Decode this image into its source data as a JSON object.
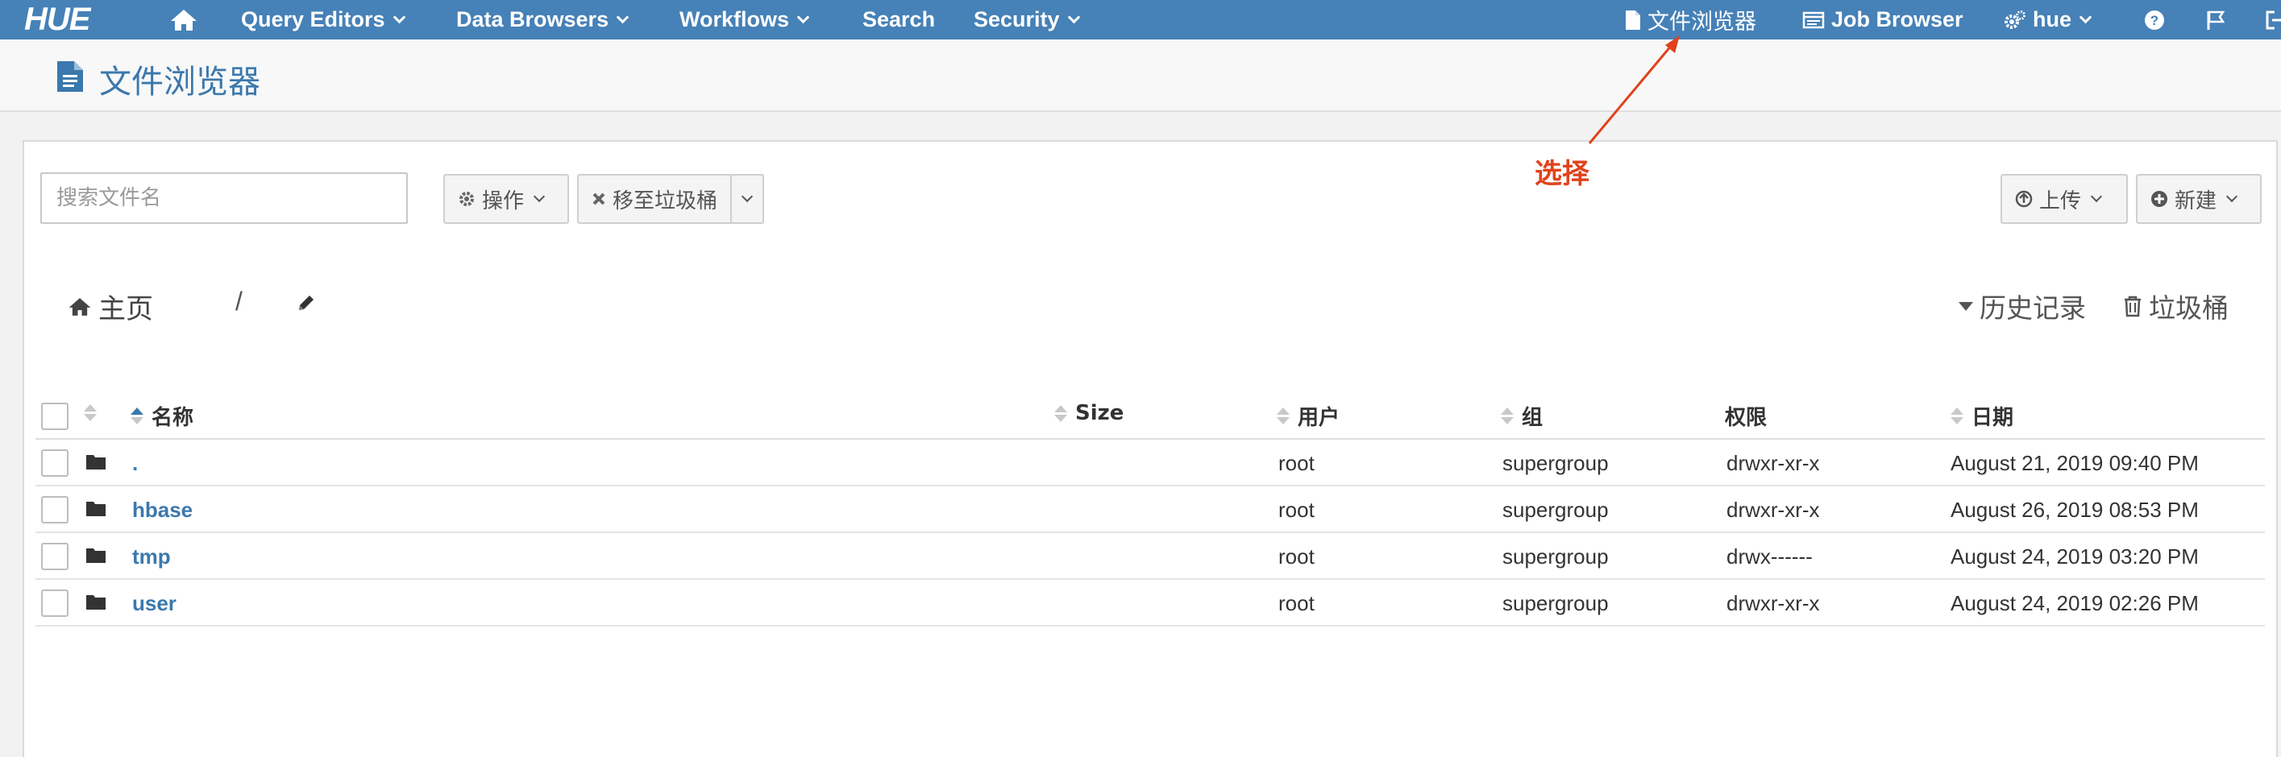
{
  "topnav": {
    "logo": "HUE",
    "menus": [
      {
        "label": "Query Editors"
      },
      {
        "label": "Data Browsers"
      },
      {
        "label": "Workflows"
      },
      {
        "label": "Search"
      },
      {
        "label": "Security"
      }
    ],
    "file_browser_label": "文件浏览器",
    "job_browser_label": "Job Browser",
    "user_label": "hue"
  },
  "header": {
    "title": "文件浏览器"
  },
  "toolbar": {
    "search_placeholder": "搜索文件名",
    "actions_label": "操作",
    "trash_move_label": "移至垃圾桶",
    "upload_label": "上传",
    "new_label": "新建"
  },
  "annotation": {
    "text": "选择",
    "color": "#e0421c"
  },
  "breadcrumb": {
    "home_label": "主页",
    "separator": "/"
  },
  "right_links": {
    "history_label": "历史记录",
    "trash_label": "垃圾桶"
  },
  "table": {
    "columns": {
      "name": "名称",
      "size": "Size",
      "user": "用户",
      "group": "组",
      "permissions": "权限",
      "date": "日期"
    },
    "rows": [
      {
        "name": ".",
        "size": "",
        "user": "root",
        "group": "supergroup",
        "permissions": "drwxr-xr-x",
        "date": "August 21, 2019 09:40 PM"
      },
      {
        "name": "hbase",
        "size": "",
        "user": "root",
        "group": "supergroup",
        "permissions": "drwxr-xr-x",
        "date": "August 26, 2019 08:53 PM"
      },
      {
        "name": "tmp",
        "size": "",
        "user": "root",
        "group": "supergroup",
        "permissions": "drwx------",
        "date": "August 24, 2019 03:20 PM"
      },
      {
        "name": "user",
        "size": "",
        "user": "root",
        "group": "supergroup",
        "permissions": "drwxr-xr-x",
        "date": "August 24, 2019 02:26 PM"
      }
    ]
  },
  "colors": {
    "nav_bg": "#4681b7",
    "link": "#3b78ad",
    "annotation": "#e0421c"
  },
  "icons": [
    "home-icon",
    "file-icon",
    "job-browser-icon",
    "cogs-icon",
    "help-icon",
    "flag-icon",
    "logout-icon",
    "gear-icon",
    "close-icon",
    "upload-icon",
    "plus-icon",
    "pencil-icon",
    "caret-down-icon",
    "trash-icon",
    "folder-icon"
  ]
}
